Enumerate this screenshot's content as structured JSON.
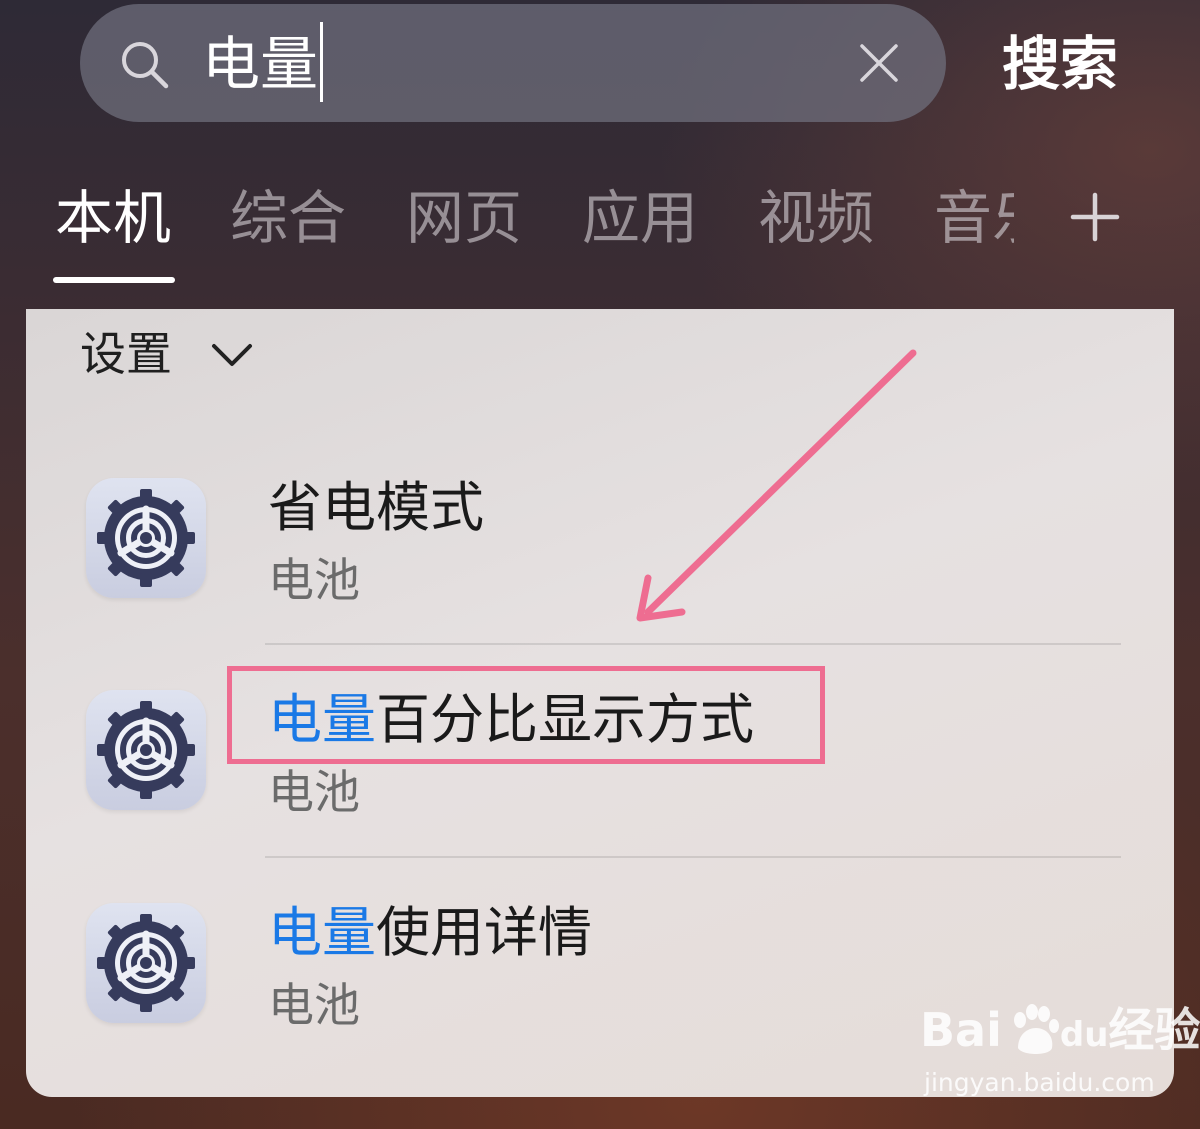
{
  "search": {
    "query": "电量",
    "submit_label": "搜索"
  },
  "tabs": [
    {
      "label": "本机",
      "active": true
    },
    {
      "label": "综合",
      "active": false
    },
    {
      "label": "网页",
      "active": false
    },
    {
      "label": "应用",
      "active": false
    },
    {
      "label": "视频",
      "active": false
    },
    {
      "label": "音乐",
      "active": false
    }
  ],
  "icons": {
    "search": "search-icon",
    "clear": "close-icon",
    "add_tab": "plus-icon",
    "section_toggle": "chevron-down-icon",
    "result": "settings-gear-icon"
  },
  "section": {
    "title": "设置"
  },
  "results": [
    {
      "highlight": "",
      "title_rest": "省电模式",
      "subtitle": "电池"
    },
    {
      "highlight": "电量",
      "title_rest": "百分比显示方式",
      "subtitle": "电池"
    },
    {
      "highlight": "电量",
      "title_rest": "使用详情",
      "subtitle": "电池"
    }
  ],
  "colors": {
    "highlight_text": "#1a79e6",
    "annotation": "#ee6d91"
  },
  "watermark": {
    "brand_left": "Bai",
    "brand_mid": "du",
    "brand_right": "经验",
    "url": "jingyan.baidu.com"
  }
}
